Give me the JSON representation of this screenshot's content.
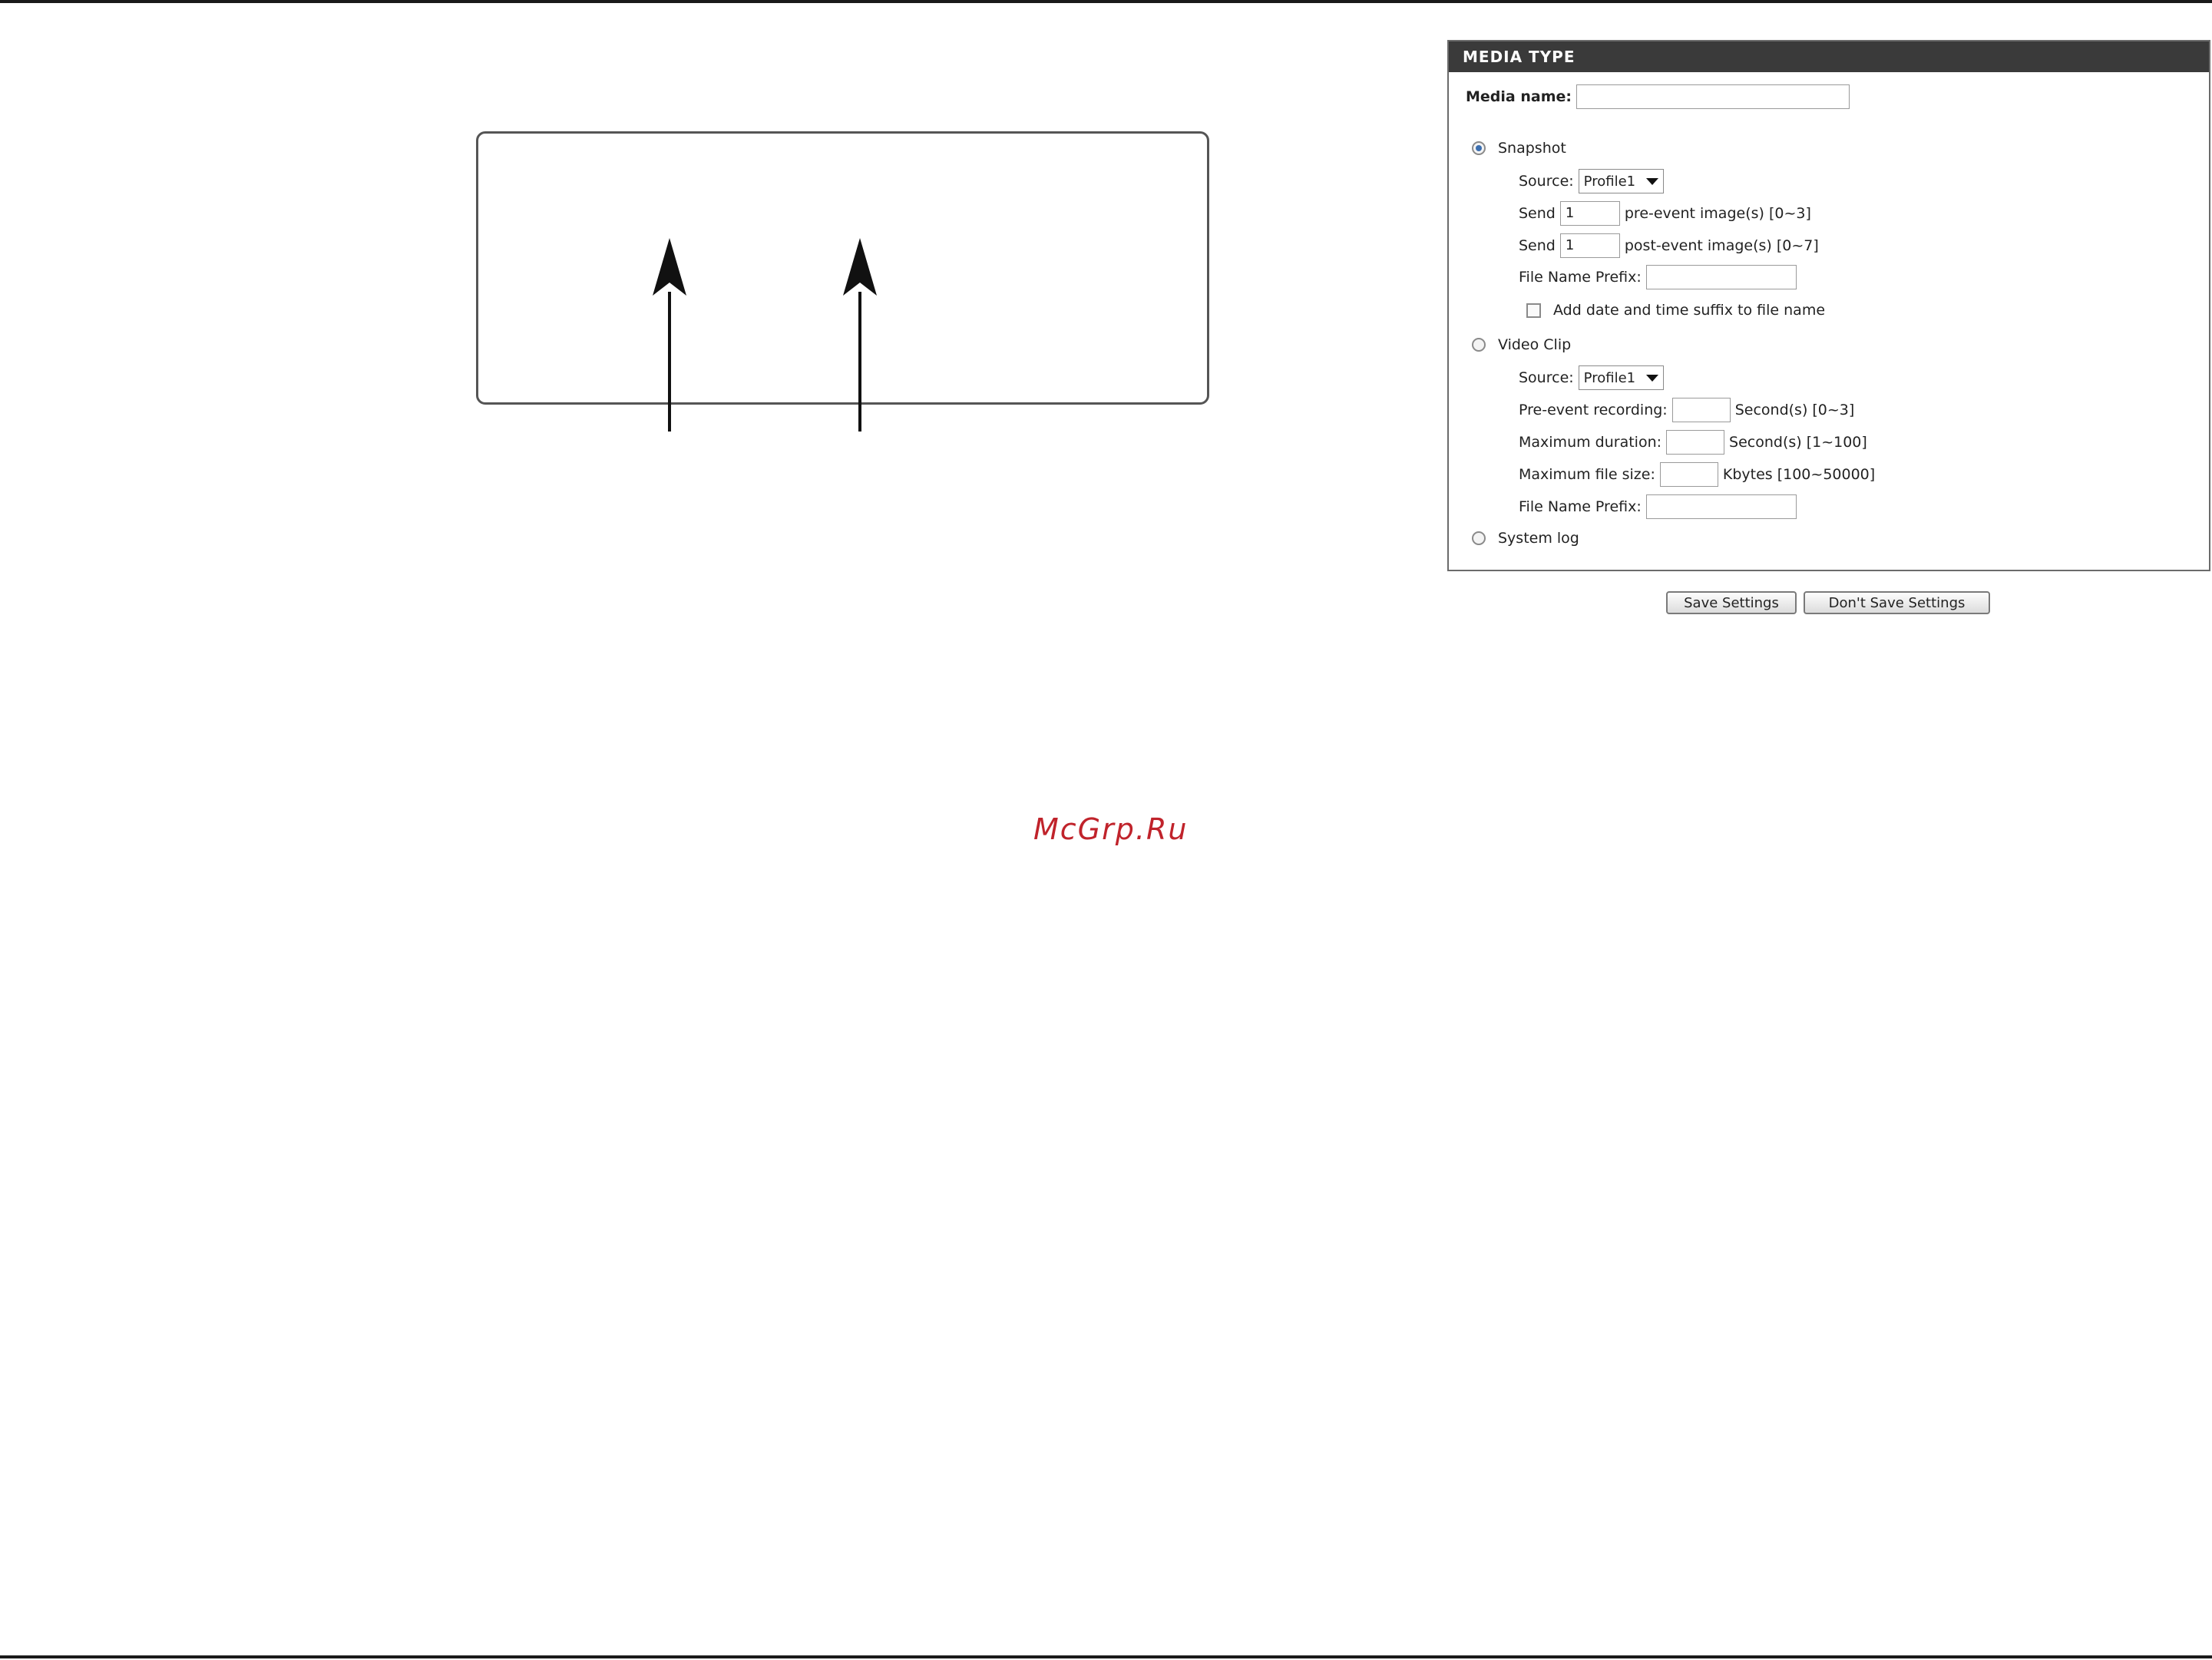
{
  "panel": {
    "title": "MEDIA TYPE",
    "media_name_label": "Media name:",
    "media_name_value": "",
    "snapshot": {
      "label": "Snapshot",
      "selected": true,
      "source_label": "Source:",
      "source_value": "Profile1",
      "send_label": "Send",
      "pre_value": "1",
      "pre_suffix": "pre-event image(s) [0~3]",
      "post_value": "1",
      "post_suffix": "post-event image(s) [0~7]",
      "prefix_label": "File Name Prefix:",
      "prefix_value": "",
      "suffix_checkbox_label": "Add date and time suffix to file name"
    },
    "video_clip": {
      "label": "Video Clip",
      "selected": false,
      "source_label": "Source:",
      "source_value": "Profile1",
      "pre_event_label": "Pre-event recording:",
      "pre_event_value": "",
      "pre_event_suffix": "Second(s) [0~3]",
      "max_duration_label": "Maximum duration:",
      "max_duration_value": "",
      "max_duration_suffix": "Second(s) [1~100]",
      "max_size_label": "Maximum file size:",
      "max_size_value": "",
      "max_size_suffix": "Kbytes [100~50000]",
      "prefix_label": "File Name Prefix:",
      "prefix_value": ""
    },
    "system_log": {
      "label": "System log",
      "selected": false
    }
  },
  "buttons": {
    "save": "Save Settings",
    "dont_save": "Don't Save Settings"
  },
  "watermark": "McGrp.Ru"
}
